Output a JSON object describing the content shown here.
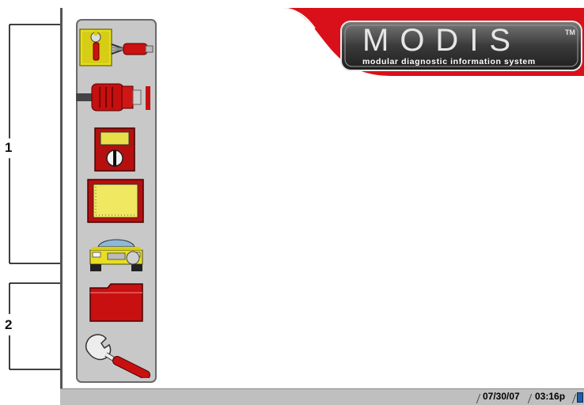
{
  "callouts": [
    {
      "label": "1"
    },
    {
      "label": "2"
    }
  ],
  "logo": {
    "wordmark": "MODIS",
    "trademark": "TM",
    "tagline": "modular diagnostic information system"
  },
  "toolbar": {
    "items": [
      {
        "icon": "scanner-icon",
        "selected": true
      },
      {
        "icon": "connector-cable-icon",
        "selected": false
      },
      {
        "icon": "multimeter-icon",
        "selected": false
      },
      {
        "icon": "oscilloscope-icon",
        "selected": false
      },
      {
        "icon": "vehicle-icon",
        "selected": false
      },
      {
        "icon": "folder-icon",
        "selected": false
      },
      {
        "icon": "wrench-icon",
        "selected": false
      }
    ]
  },
  "status_bar": {
    "date": "07/30/07",
    "time": "03:16p"
  },
  "colors": {
    "brand_red": "#d9101a",
    "toolbar_bg": "#c8c8c8",
    "selected_bg": "#e6dd1e"
  }
}
